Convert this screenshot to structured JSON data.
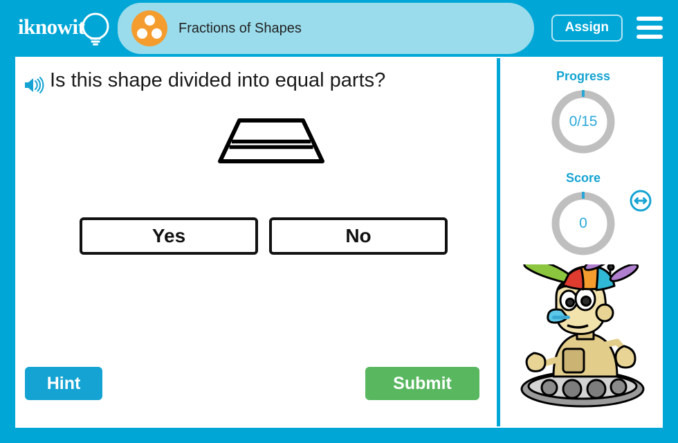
{
  "brand": {
    "logo_text": "iknowit",
    "logo_icon": "lightbulb-icon"
  },
  "header": {
    "lesson_title": "Fractions of Shapes",
    "lesson_icon": "three-dots-circle-icon",
    "assign_label": "Assign",
    "menu_icon": "hamburger-menu-icon"
  },
  "question": {
    "audio_icon": "speaker-icon",
    "text": "Is this shape divided into equal parts?",
    "shape": {
      "name": "trapezoid-divided-into-three-bands",
      "divisions": 3,
      "equal_parts": false
    }
  },
  "answers": [
    {
      "label": "Yes",
      "name": "answer-yes"
    },
    {
      "label": "No",
      "name": "answer-no"
    }
  ],
  "actions": {
    "hint_label": "Hint",
    "submit_label": "Submit"
  },
  "rail": {
    "progress": {
      "label": "Progress",
      "value": "0/15",
      "completed": 0,
      "total": 15,
      "percent": 0
    },
    "score": {
      "label": "Score",
      "value": "0",
      "points": 0,
      "percent": 0
    },
    "mascot_name": "robot-mascot-with-propeller-cap",
    "resize_icon": "resize-horizontal-icon"
  },
  "colors": {
    "brand_teal": "#00a6d6",
    "tab_light_teal": "#9adcec",
    "accent_teal": "#14a3d2",
    "submit_green": "#58b75f",
    "lesson_orange": "#f59c2e",
    "ring_gray": "#bfbfbf",
    "text_dark": "#1a1a1a"
  }
}
